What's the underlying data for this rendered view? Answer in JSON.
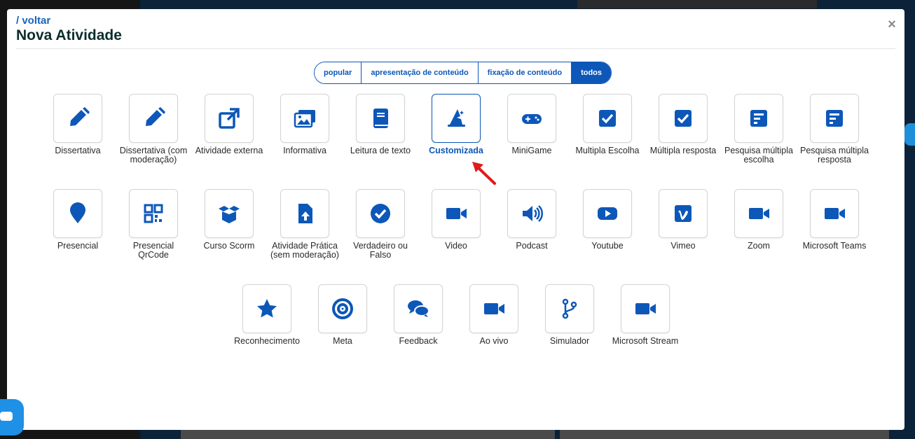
{
  "header": {
    "back_label": "/ voltar",
    "title": "Nova Atividade",
    "close_label": "×"
  },
  "filters": [
    {
      "label": "popular",
      "active": false
    },
    {
      "label": "apresentação de conteúdo",
      "active": false
    },
    {
      "label": "fixação de conteúdo",
      "active": false
    },
    {
      "label": "todos",
      "active": true
    }
  ],
  "colors": {
    "accent": "#0d57b8",
    "title": "#0d2d2d",
    "arrow": "#e01b1b"
  },
  "activities": {
    "row1": [
      {
        "label": "Dissertativa",
        "icon": "pencil-icon"
      },
      {
        "label": "Dissertativa (com moderação)",
        "icon": "pencil-icon"
      },
      {
        "label": "Atividade externa",
        "icon": "external-link-icon"
      },
      {
        "label": "Informativa",
        "icon": "images-icon"
      },
      {
        "label": "Leitura de texto",
        "icon": "book-icon"
      },
      {
        "label": "Customizada",
        "icon": "wizard-hat-icon",
        "selected": true
      },
      {
        "label": "MiniGame",
        "icon": "gamepad-icon"
      },
      {
        "label": "Multipla Escolha",
        "icon": "checkbox-icon"
      },
      {
        "label": "Múltipla resposta",
        "icon": "checkbox-icon"
      },
      {
        "label": "Pesquisa múltipla escolha",
        "icon": "poll-icon"
      },
      {
        "label": "Pesquisa múltipla resposta",
        "icon": "poll-icon"
      }
    ],
    "row2": [
      {
        "label": "Presencial",
        "icon": "map-pin-icon"
      },
      {
        "label": "Presencial QrCode",
        "icon": "qrcode-icon"
      },
      {
        "label": "Curso Scorm",
        "icon": "box-open-icon"
      },
      {
        "label": "Atividade Prática (sem moderação)",
        "icon": "file-upload-icon"
      },
      {
        "label": "Verdadeiro ou Falso",
        "icon": "check-circle-icon"
      },
      {
        "label": "Video",
        "icon": "video-icon"
      },
      {
        "label": "Podcast",
        "icon": "volume-icon"
      },
      {
        "label": "Youtube",
        "icon": "youtube-icon"
      },
      {
        "label": "Vimeo",
        "icon": "vimeo-icon"
      },
      {
        "label": "Zoom",
        "icon": "video-icon"
      },
      {
        "label": "Microsoft Teams",
        "icon": "video-icon"
      }
    ],
    "row3": [
      {
        "label": "Reconhecimento",
        "icon": "star-icon"
      },
      {
        "label": "Meta",
        "icon": "target-icon"
      },
      {
        "label": "Feedback",
        "icon": "comments-icon"
      },
      {
        "label": "Ao vivo",
        "icon": "video-icon"
      },
      {
        "label": "Simulador",
        "icon": "code-branch-icon"
      },
      {
        "label": "Microsoft Stream",
        "icon": "video-icon"
      }
    ]
  }
}
